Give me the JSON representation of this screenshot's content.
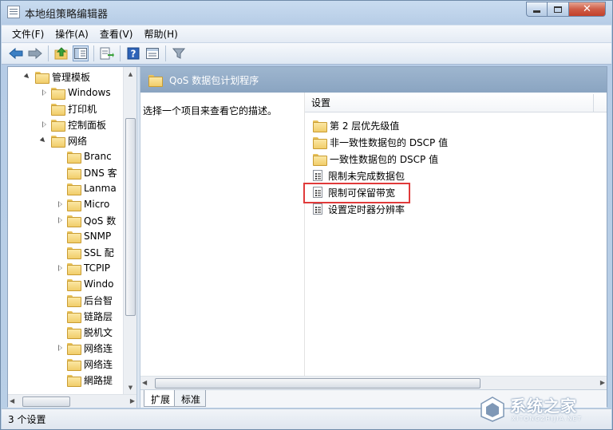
{
  "window": {
    "title": "本地组策略编辑器"
  },
  "menu": {
    "items": [
      "文件(F)",
      "操作(A)",
      "查看(V)",
      "帮助(H)"
    ]
  },
  "toolbar": {
    "icons": [
      "back-arrow-icon",
      "forward-arrow-icon",
      "up-folder-icon",
      "show-hide-tree-icon",
      "export-list-icon",
      "help-icon",
      "properties-pane-icon",
      "filter-icon"
    ]
  },
  "tree": {
    "items": [
      {
        "label": "管理模板",
        "state": "open"
      },
      {
        "label": "Windows",
        "state": "closed"
      },
      {
        "label": "打印机",
        "state": "none"
      },
      {
        "label": "控制面板",
        "state": "closed"
      },
      {
        "label": "网络",
        "state": "open"
      },
      {
        "label": "Branc",
        "state": "none"
      },
      {
        "label": "DNS 客",
        "state": "none"
      },
      {
        "label": "Lanma",
        "state": "none"
      },
      {
        "label": "Micro",
        "state": "closed"
      },
      {
        "label": "QoS 数",
        "state": "closed"
      },
      {
        "label": "SNMP",
        "state": "none"
      },
      {
        "label": "SSL 配",
        "state": "none"
      },
      {
        "label": "TCPIP",
        "state": "closed"
      },
      {
        "label": "Windo",
        "state": "none"
      },
      {
        "label": "后台智",
        "state": "none"
      },
      {
        "label": "链路层",
        "state": "none"
      },
      {
        "label": "脱机文",
        "state": "none"
      },
      {
        "label": "网络连",
        "state": "closed"
      },
      {
        "label": "网络连",
        "state": "none"
      },
      {
        "label": "網路提",
        "state": "none"
      }
    ]
  },
  "pane": {
    "header": "QoS 数据包计划程序",
    "description": "选择一个项目来查看它的描述。",
    "column": "设置",
    "rows": [
      {
        "label": "第 2 层优先级值",
        "type": "folder"
      },
      {
        "label": "非一致性数据包的 DSCP 值",
        "type": "folder"
      },
      {
        "label": "一致性数据包的 DSCP 值",
        "type": "folder"
      },
      {
        "label": "限制未完成数据包",
        "type": "setting"
      },
      {
        "label": "限制可保留带宽",
        "type": "setting"
      },
      {
        "label": "设置定时器分辨率",
        "type": "setting"
      }
    ]
  },
  "tabs": {
    "extended": "扩展",
    "standard": "标准"
  },
  "status": {
    "text": "3 个设置"
  },
  "watermark": {
    "name": "系统之家",
    "sub": "XITONGZHIJIA.NET"
  },
  "colors": {
    "highlight": "#e03a3a",
    "header_bg": "#8aa4c1",
    "accent": "#3b7fc4"
  }
}
